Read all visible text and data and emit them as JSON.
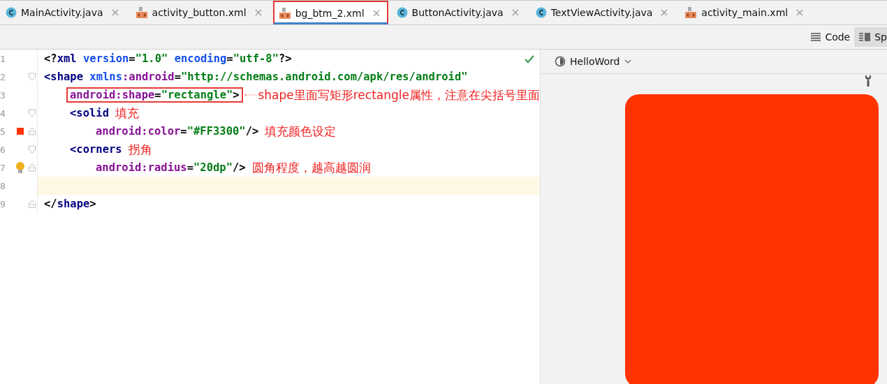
{
  "tabs": [
    {
      "label": "MainActivity.java",
      "kind": "java",
      "selected": false,
      "highlighted": false
    },
    {
      "label": "activity_button.xml",
      "kind": "xml",
      "selected": false,
      "highlighted": false
    },
    {
      "label": "bg_btm_2.xml",
      "kind": "xml",
      "selected": true,
      "highlighted": true
    },
    {
      "label": "ButtonActivity.java",
      "kind": "java",
      "selected": false,
      "highlighted": false
    },
    {
      "label": "TextViewActivity.java",
      "kind": "java",
      "selected": false,
      "highlighted": false
    },
    {
      "label": "activity_main.xml",
      "kind": "xml",
      "selected": false,
      "highlighted": false
    }
  ],
  "view_modes": [
    {
      "label": "Code",
      "kind": "code",
      "selected": false
    },
    {
      "label": "Sp",
      "kind": "split",
      "selected": true
    }
  ],
  "editor": {
    "lines": [
      {
        "number": "1",
        "current": false,
        "boxed": false,
        "tokens": [
          {
            "text": "<?",
            "kind": "plain"
          },
          {
            "text": "xml",
            "kind": "tag"
          },
          {
            "text": " version",
            "kind": "attr"
          },
          {
            "text": "=",
            "kind": "plain"
          },
          {
            "text": "\"1.0\"",
            "kind": "value"
          },
          {
            "text": " encoding",
            "kind": "attr"
          },
          {
            "text": "=",
            "kind": "plain"
          },
          {
            "text": "\"utf-8\"",
            "kind": "value"
          },
          {
            "text": "?>",
            "kind": "plain"
          }
        ]
      },
      {
        "number": "2",
        "current": false,
        "boxed": false,
        "fold": {
          "kind": "start"
        },
        "tokens": [
          {
            "text": "<shape",
            "kind": "tag"
          },
          {
            "text": " xmlns",
            "kind": "attr"
          },
          {
            "text": ":android",
            "kind": "ns"
          },
          {
            "text": "=",
            "kind": "plain"
          },
          {
            "text": "\"http://schemas.android.com/apk/res/android\"",
            "kind": "value"
          }
        ],
        "children": [
          {
            "number": "3",
            "current": false,
            "boxed": true,
            "tokens": [
              {
                "text": "android:shape",
                "kind": "ns"
              },
              {
                "text": "=",
                "kind": "plain"
              },
              {
                "text": "\"rectangle\"",
                "kind": "value"
              },
              {
                "text": ">",
                "kind": "plain"
              }
            ],
            "annotation": {
              "text": "shape里面写矩形rectangle属性，注意在尖括号里面",
              "arrow": true
            }
          },
          {
            "number": "4",
            "current": false,
            "boxed": false,
            "fold": {
              "kind": "start"
            },
            "tokens": [
              {
                "text": "<solid",
                "kind": "tag"
              }
            ],
            "annotation": {
              "text": "填充",
              "arrow": false
            },
            "children": [
              {
                "number": "5",
                "current": false,
                "boxed": false,
                "fold": {
                  "kind": "end"
                },
                "marker": {
                  "kind": "swatch",
                  "color": "#ff3300"
                },
                "tokens": [
                  {
                    "text": "android:color",
                    "kind": "ns"
                  },
                  {
                    "text": "=",
                    "kind": "plain"
                  },
                  {
                    "text": "\"#FF3300\"",
                    "kind": "value"
                  },
                  {
                    "text": "/>",
                    "kind": "plain"
                  }
                ],
                "annotation": {
                  "text": "填充颜色设定",
                  "arrow": false
                }
              }
            ]
          },
          {
            "number": "6",
            "current": false,
            "boxed": false,
            "fold": {
              "kind": "start"
            },
            "tokens": [
              {
                "text": "<corners",
                "kind": "tag"
              }
            ],
            "annotation": {
              "text": "拐角",
              "arrow": false
            },
            "children": [
              {
                "number": "7",
                "current": false,
                "boxed": false,
                "fold": {
                  "kind": "end"
                },
                "marker": {
                  "kind": "bulb"
                },
                "tokens": [
                  {
                    "text": "android:radius",
                    "kind": "ns"
                  },
                  {
                    "text": "=",
                    "kind": "plain"
                  },
                  {
                    "text": "\"20dp\"",
                    "kind": "value"
                  },
                  {
                    "text": "/>",
                    "kind": "plain"
                  }
                ],
                "annotation": {
                  "text": "圆角程度，越高越圆润",
                  "arrow": false
                }
              }
            ]
          }
        ]
      },
      {
        "number": "8",
        "current": true
      },
      {
        "number": "9",
        "current": false,
        "boxed": false,
        "fold": {
          "kind": "end"
        },
        "tokens": [
          {
            "text": "</",
            "kind": "plain"
          },
          {
            "text": "shape",
            "kind": "tag"
          },
          {
            "text": ">",
            "kind": "plain"
          }
        ]
      }
    ]
  },
  "preview": {
    "theme": "HelloWord",
    "color": "#ff3300"
  }
}
